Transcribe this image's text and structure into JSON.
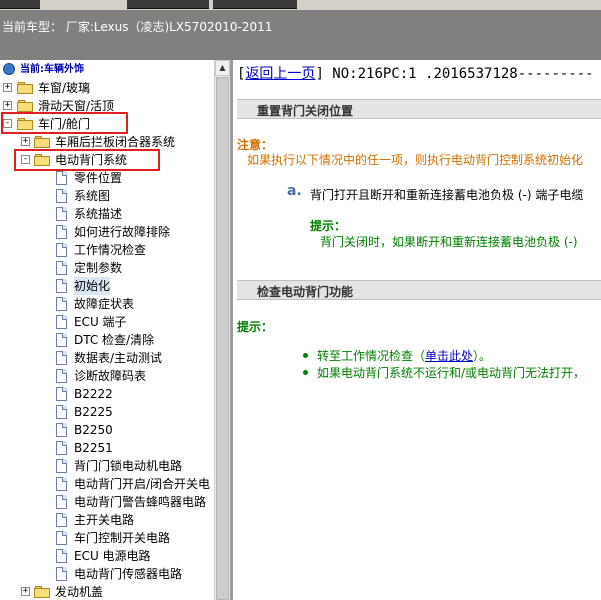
{
  "vehicle_bar": {
    "label": "当前车型： 厂家:Lexus（凌志)LX5702010-2011"
  },
  "tree": {
    "root_label": "当前:车辆外饰",
    "items": [
      {
        "label": "车窗/玻璃",
        "type": "folder",
        "expander": "+"
      },
      {
        "label": "滑动天窗/活顶",
        "type": "folder",
        "expander": "+"
      },
      {
        "label": "车门/舱门",
        "type": "folder-open",
        "expander": "-"
      },
      {
        "label": "车厢后拦板闭合器系统",
        "type": "folder",
        "expander": "+"
      },
      {
        "label": "电动背门系统",
        "type": "folder-open",
        "expander": "-"
      },
      {
        "label": "零件位置",
        "type": "doc"
      },
      {
        "label": "系统图",
        "type": "doc"
      },
      {
        "label": "系统描述",
        "type": "doc"
      },
      {
        "label": "如何进行故障排除",
        "type": "doc"
      },
      {
        "label": "工作情况检查",
        "type": "doc"
      },
      {
        "label": "定制参数",
        "type": "doc"
      },
      {
        "label": "初始化",
        "type": "doc",
        "selected": true
      },
      {
        "label": "故障症状表",
        "type": "doc"
      },
      {
        "label": "ECU 端子",
        "type": "doc"
      },
      {
        "label": "DTC 检查/清除",
        "type": "doc"
      },
      {
        "label": "数据表/主动测试",
        "type": "doc"
      },
      {
        "label": "诊断故障码表",
        "type": "doc"
      },
      {
        "label": "B2222",
        "type": "doc"
      },
      {
        "label": "B2225",
        "type": "doc"
      },
      {
        "label": "B2250",
        "type": "doc"
      },
      {
        "label": "B2251",
        "type": "doc"
      },
      {
        "label": "背门门锁电动机电路",
        "type": "doc"
      },
      {
        "label": "电动背门开启/闭合开关电",
        "type": "doc"
      },
      {
        "label": "电动背门警告蜂鸣器电路",
        "type": "doc"
      },
      {
        "label": "主开关电路",
        "type": "doc"
      },
      {
        "label": "车门控制开关电路",
        "type": "doc"
      },
      {
        "label": "ECU 电源电路",
        "type": "doc"
      },
      {
        "label": "电动背门传感器电路",
        "type": "doc"
      },
      {
        "label": "发动机盖",
        "type": "folder",
        "expander": "+"
      }
    ]
  },
  "content": {
    "back_link": "返回上一页",
    "doc_id": "NO:216PC:1 .2016537128---------",
    "section1_title": "重置背门关闭位置",
    "caution_label": "注意：",
    "caution_text": "如果执行以下情况中的任一项，则执行电动背门控制系统初始化",
    "step_letter": "a.",
    "step_text": "背门打开且断开和重新连接蓄电池负极 (-) 端子电缆",
    "hint1_label": "提示：",
    "hint1_text": "背门关闭时，如果断开和重新连接蓄电池负极 (-)",
    "section2_title": "检查电动背门功能",
    "hint2_label": "提示：",
    "bullet1_prefix": "转至工作情况检查（",
    "bullet1_link": "单击此处",
    "bullet1_suffix": "）。",
    "bullet2_text": "如果电动背门系统不运行和/或电动背门无法打开，"
  },
  "colors": {
    "caution": "#d07000",
    "hint": "#008000",
    "link": "#0000cc",
    "highlight_box": "#e02020"
  }
}
